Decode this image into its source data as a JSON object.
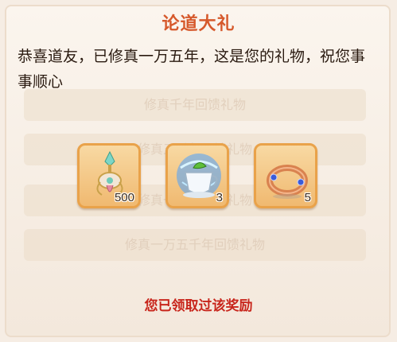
{
  "dialog": {
    "title": "论道大礼",
    "message": "恭喜道友，已修真一万五年，这是您的礼物，祝您事事顺心",
    "background_rows": [
      "修真千年回馈礼物",
      "修真五千年回馈礼物",
      "修真一万年回馈礼物",
      "修真一万五千年回馈礼物"
    ],
    "rewards": [
      {
        "icon": "jade-pendant-icon",
        "count": "500"
      },
      {
        "icon": "spirit-tea-cup-icon",
        "count": "3"
      },
      {
        "icon": "gem-ring-icon",
        "count": "5"
      }
    ],
    "status": "您已领取过该奖励"
  },
  "colors": {
    "title": "#d6592c",
    "status": "#c8261c",
    "item_border": "#e9a24a"
  }
}
